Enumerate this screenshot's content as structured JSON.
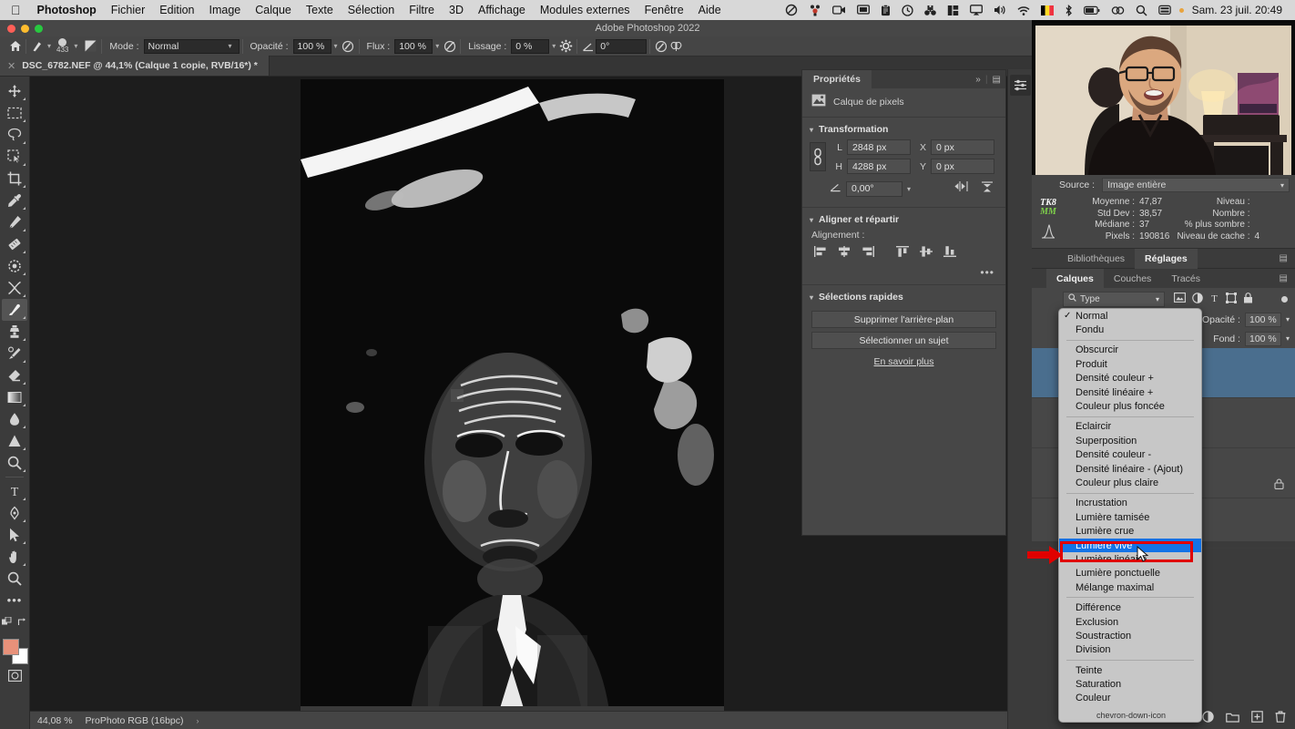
{
  "macmenu": {
    "apple": "apple-logo",
    "items": [
      "Photoshop",
      "Fichier",
      "Edition",
      "Image",
      "Calque",
      "Texte",
      "Sélection",
      "Filtre",
      "3D",
      "Affichage",
      "Modules externes",
      "Fenêtre",
      "Aide"
    ],
    "right_icons": [
      "do-not-disturb-icon",
      "cluster-icon",
      "screen-record-icon",
      "display-icon",
      "clipboard-icon",
      "time-machine-icon",
      "binoculars-icon",
      "stats-icon",
      "airplay-icon",
      "volume-icon",
      "wifi-icon",
      "flag-belgium-icon",
      "bluetooth-icon",
      "battery-icon",
      "link-icon",
      "search-icon",
      "control-center-icon"
    ],
    "clock": "Sam. 23 juil.  20:49"
  },
  "titlebar": {
    "title": "Adobe Photoshop 2022"
  },
  "options_bar": {
    "home_icon": "home-icon",
    "brush_icon": "brush-preset-icon",
    "brush_size": "433",
    "brush_panel_icon": "brush-panel-icon",
    "mode_label": "Mode :",
    "mode_value": "Normal",
    "opacity_label": "Opacité :",
    "opacity_value": "100 %",
    "pressure_opacity_icon": "pressure-opacity-icon",
    "flow_label": "Flux :",
    "flow_value": "100 %",
    "airbrush_icon": "airbrush-icon",
    "smoothing_label": "Lissage :",
    "smoothing_value": "0 %",
    "settings_icon": "gear-icon",
    "angle_icon": "angle-icon",
    "angle_value": "0°",
    "pressure_size_icon": "pressure-size-icon",
    "symmetry_icon": "symmetry-butterfly-icon"
  },
  "document_tab": {
    "close_icon": "close-icon",
    "title": "DSC_6782.NEF @ 44,1% (Calque 1 copie, RVB/16*) *"
  },
  "toolbar": {
    "tools": [
      {
        "name": "move-tool",
        "glyph": "✥"
      },
      {
        "name": "rectangular-marquee-tool",
        "glyph": "▭"
      },
      {
        "name": "lasso-tool",
        "glyph": "◯"
      },
      {
        "name": "object-selection-tool",
        "glyph": "❐"
      },
      {
        "name": "crop-tool",
        "glyph": "⌗"
      },
      {
        "name": "eyedropper-tool",
        "glyph": "✒"
      },
      {
        "name": "healing-brush-tool",
        "glyph": "✂"
      },
      {
        "name": "patch-tool",
        "glyph": "▨"
      },
      {
        "name": "spot-healing-tool",
        "glyph": "◌"
      },
      {
        "name": "mixer-brush-tool",
        "glyph": "✖"
      },
      {
        "name": "brush-tool",
        "glyph": "🖌",
        "selected": true
      },
      {
        "name": "clone-stamp-tool",
        "glyph": "⌾"
      },
      {
        "name": "history-brush-tool",
        "glyph": "🖋"
      },
      {
        "name": "eraser-tool",
        "glyph": "◣"
      },
      {
        "name": "gradient-tool",
        "glyph": "▰"
      },
      {
        "name": "blur-tool",
        "glyph": "◍"
      },
      {
        "name": "dodge-tool",
        "glyph": "▲"
      },
      {
        "name": "zoom-magnifier-tool",
        "glyph": "🔍"
      },
      {
        "name": "type-tool",
        "glyph": "T"
      },
      {
        "name": "pen-tool",
        "glyph": "✎"
      },
      {
        "name": "path-selection-tool",
        "glyph": "➤"
      },
      {
        "name": "hand-tool",
        "glyph": "✋"
      },
      {
        "name": "zoom-tool",
        "glyph": "🔎"
      },
      {
        "name": "more-tools",
        "glyph": "•••"
      }
    ],
    "swap_colors_icon": "swap-colors-icon",
    "default_colors_icon": "default-colors-icon",
    "foreground_color": "#e8917a",
    "background_color": "#ffffff",
    "quickmask_icon": "quick-mask-icon"
  },
  "statusbar": {
    "zoom": "44,08 %",
    "colorspace": "ProPhoto RGB (16bpc)",
    "arrow": "›"
  },
  "properties": {
    "tab_label": "Propriétés",
    "collapse_icon": "double-chevron-icon",
    "panel_menu_icon": "panel-menu-icon",
    "layer_type_icon": "pixel-layer-icon",
    "layer_type": "Calque de pixels",
    "transform": {
      "title": "Transformation",
      "link_icon": "link-dimensions-icon",
      "w_label": "L",
      "w_value": "2848 px",
      "h_label": "H",
      "h_value": "4288 px",
      "x_label": "X",
      "x_value": "0 px",
      "y_label": "Y",
      "y_value": "0 px",
      "angle_icon": "angle-icon",
      "angle_value": "0,00°",
      "flip_h_icon": "flip-horizontal-icon",
      "flip_v_icon": "flip-vertical-icon"
    },
    "align": {
      "title": "Aligner et répartir",
      "label": "Alignement :",
      "icons": [
        "align-left-icon",
        "align-center-h-icon",
        "align-right-icon",
        "align-top-icon",
        "align-middle-v-icon",
        "align-bottom-icon"
      ],
      "more": "•••"
    },
    "quick_actions": {
      "title": "Sélections rapides",
      "remove_bg": "Supprimer l'arrière-plan",
      "select_subject": "Sélectionner un sujet",
      "learn_more": "En savoir plus"
    }
  },
  "rail": {
    "adjustments_icon": "adjustments-sliders-icon"
  },
  "histogram": {
    "source_label": "Source :",
    "source_value": "Image entière",
    "chevron_icon": "chevron-down-icon",
    "watermark": "TK8",
    "watermark_sub": "MM",
    "curve_icon": "curve-icon",
    "stats_left": [
      {
        "key": "Moyenne :",
        "value": "47,87"
      },
      {
        "key": "Std Dev :",
        "value": "38,57"
      },
      {
        "key": "Médiane :",
        "value": "37"
      },
      {
        "key": "Pixels :",
        "value": "190816"
      }
    ],
    "stats_right": [
      {
        "key": "Niveau :",
        "value": ""
      },
      {
        "key": "Nombre :",
        "value": ""
      },
      {
        "key": "% plus sombre :",
        "value": ""
      },
      {
        "key": "Niveau de cache :",
        "value": "4"
      }
    ]
  },
  "panel_tabs_upper": {
    "tabs": [
      {
        "label": "Bibliothèques",
        "active": false
      },
      {
        "label": "Réglages",
        "active": true
      }
    ],
    "menu_icon": "panel-menu-icon"
  },
  "panel_tabs_lower": {
    "tabs": [
      {
        "label": "Calques",
        "active": true
      },
      {
        "label": "Couches",
        "active": false
      },
      {
        "label": "Tracés",
        "active": false
      }
    ],
    "menu_icon": "panel-menu-icon"
  },
  "layers": {
    "filter_icon": "search-icon",
    "filter_value": "Type",
    "filter_chevron": "chevron-down-icon",
    "filter_icons": [
      "pixel-filter-icon",
      "adjustment-filter-icon",
      "type-filter-icon",
      "shape-filter-icon",
      "smart-object-filter-icon"
    ],
    "filter_toggle": "filter-toggle-icon",
    "blend_mode_chevron": "chevron-down-icon",
    "opacity_label": "Opacité :",
    "opacity_value": "100 %",
    "fill_label": "Fond :",
    "fill_value": "100 %",
    "lock_icon": "lock-icon",
    "footer_icons": [
      "link-layers-icon",
      "layer-style-icon",
      "layer-mask-icon",
      "adjustment-layer-icon",
      "new-group-icon",
      "new-layer-icon",
      "delete-layer-icon"
    ]
  },
  "blend_dropdown": {
    "groups": [
      {
        "items": [
          {
            "label": "Normal",
            "checked": true
          },
          {
            "label": "Fondu"
          }
        ]
      },
      {
        "items": [
          {
            "label": "Obscurcir"
          },
          {
            "label": "Produit"
          },
          {
            "label": "Densité couleur +"
          },
          {
            "label": "Densité linéaire +"
          },
          {
            "label": "Couleur plus foncée"
          }
        ]
      },
      {
        "items": [
          {
            "label": "Eclaircir"
          },
          {
            "label": "Superposition"
          },
          {
            "label": "Densité couleur -"
          },
          {
            "label": "Densité linéaire - (Ajout)"
          },
          {
            "label": "Couleur plus claire"
          }
        ]
      },
      {
        "items": [
          {
            "label": "Incrustation"
          },
          {
            "label": "Lumière tamisée"
          },
          {
            "label": "Lumière crue"
          },
          {
            "label": "Lumière vive",
            "highlighted": true
          },
          {
            "label": "Lumière linéaire"
          },
          {
            "label": "Lumière ponctuelle"
          },
          {
            "label": "Mélange maximal"
          }
        ]
      },
      {
        "items": [
          {
            "label": "Différence"
          },
          {
            "label": "Exclusion"
          },
          {
            "label": "Soustraction"
          },
          {
            "label": "Division"
          }
        ]
      },
      {
        "items": [
          {
            "label": "Teinte"
          },
          {
            "label": "Saturation"
          },
          {
            "label": "Couleur"
          }
        ]
      }
    ],
    "scroll_icon": "chevron-down-icon"
  },
  "annotation": {
    "arrow_icon": "red-arrow-icon",
    "arrow_color": "#e00000",
    "rect_color": "#e00000",
    "cursor_icon": "mouse-pointer-icon"
  },
  "colors": {
    "highlight_blue": "#1473e6",
    "selected_layer_blue": "#4a6e8e",
    "panel_bg": "#474747",
    "app_bg": "#3b3b3b"
  }
}
